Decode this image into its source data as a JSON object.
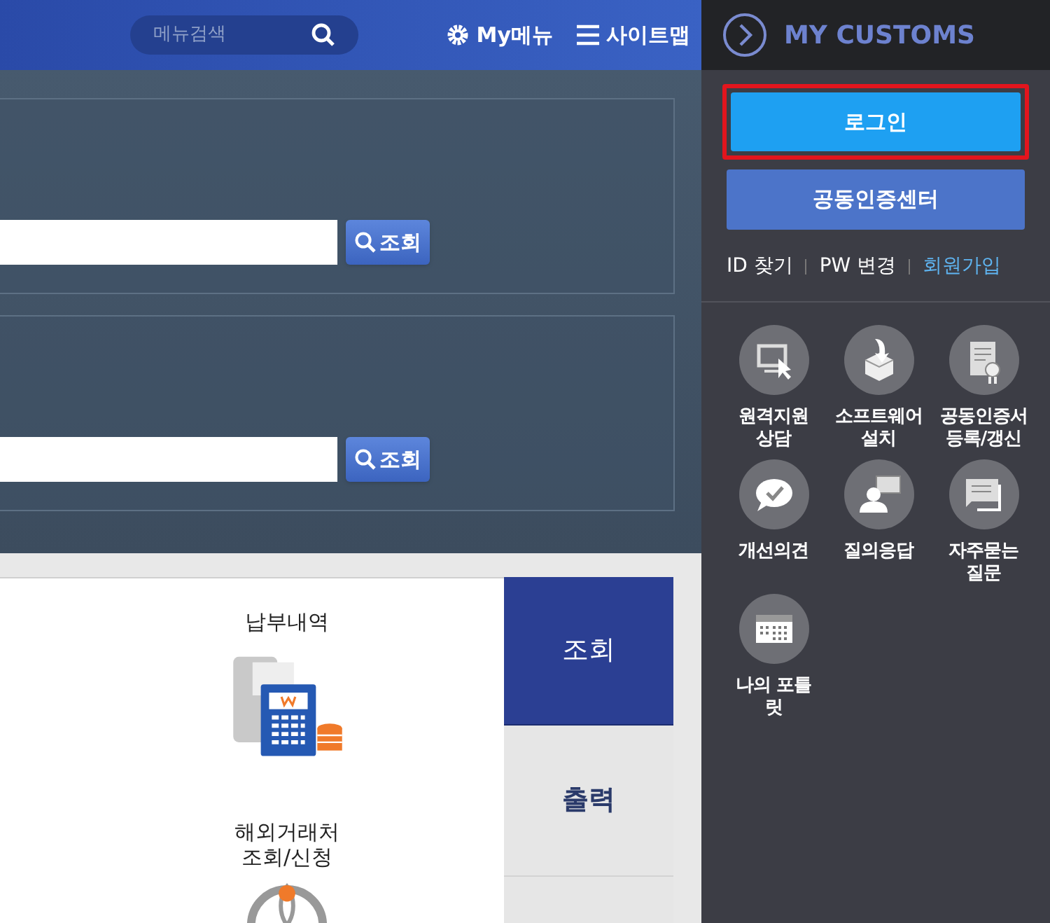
{
  "header": {
    "search": {
      "placeholder": "메뉴검색"
    },
    "links": [
      "My메뉴",
      "사이트맵"
    ]
  },
  "search_panels": [
    {
      "button": "조회"
    },
    {
      "button": "조회"
    }
  ],
  "services": [
    {
      "label": "납부내역"
    },
    {
      "label": "해외거래처\n조회/신청"
    }
  ],
  "tabs": [
    {
      "label": "조회",
      "selected": true
    },
    {
      "label": "출력",
      "selected": false
    }
  ],
  "sidebar": {
    "title": "MY CUSTOMS",
    "login_button": "로그인",
    "login_highlighted": true,
    "cert_button": "공동인증센터",
    "account_links": [
      {
        "label": "ID 찾기",
        "accent": false
      },
      {
        "label": "PW 변경",
        "accent": false
      },
      {
        "label": "회원가입",
        "accent": true
      }
    ],
    "shortcuts": [
      {
        "label": "원격지원\n상담"
      },
      {
        "label": "소프트웨어\n설치"
      },
      {
        "label": "공동인증서\n등록/갱신"
      },
      {
        "label": "개선의견"
      },
      {
        "label": "질의응답"
      },
      {
        "label": "자주묻는\n질문"
      },
      {
        "label": "나의 포틀\n릿"
      }
    ]
  }
}
